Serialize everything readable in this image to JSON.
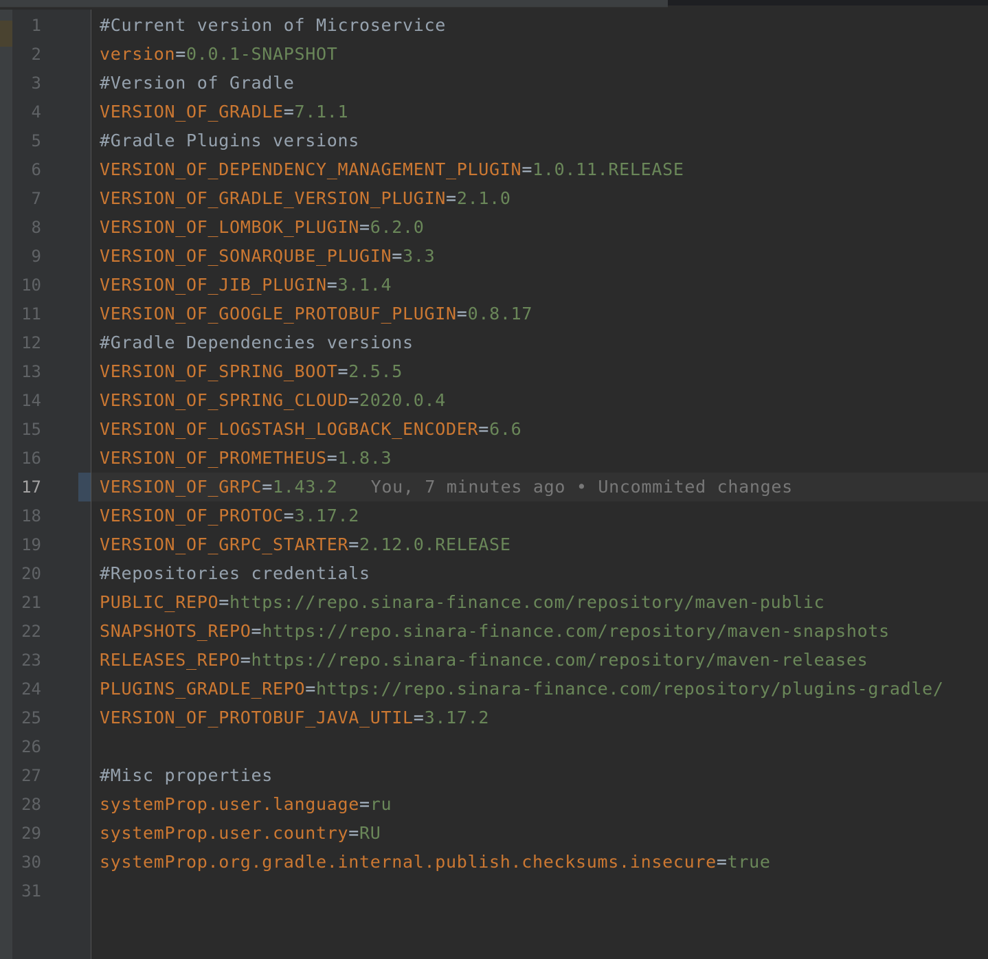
{
  "editor": {
    "current_line": 17,
    "inline_blame": "You, 7 minutes ago • Uncommited changes",
    "lines": [
      {
        "num": "1",
        "type": "comment",
        "text": "#Current version of Microservice"
      },
      {
        "num": "2",
        "type": "prop",
        "key": "version",
        "eq": "=",
        "value": "0.0.1-SNAPSHOT"
      },
      {
        "num": "3",
        "type": "comment",
        "text": "#Version of Gradle"
      },
      {
        "num": "4",
        "type": "prop",
        "key": "VERSION_OF_GRADLE",
        "eq": "=",
        "value": "7.1.1"
      },
      {
        "num": "5",
        "type": "comment",
        "text": "#Gradle Plugins versions"
      },
      {
        "num": "6",
        "type": "prop",
        "key": "VERSION_OF_DEPENDENCY_MANAGEMENT_PLUGIN",
        "eq": "=",
        "value": "1.0.11.RELEASE"
      },
      {
        "num": "7",
        "type": "prop",
        "key": "VERSION_OF_GRADLE_VERSION_PLUGIN",
        "eq": "=",
        "value": "2.1.0"
      },
      {
        "num": "8",
        "type": "prop",
        "key": "VERSION_OF_LOMBOK_PLUGIN",
        "eq": "=",
        "value": "6.2.0"
      },
      {
        "num": "9",
        "type": "prop",
        "key": "VERSION_OF_SONARQUBE_PLUGIN",
        "eq": "=",
        "value": "3.3"
      },
      {
        "num": "10",
        "type": "prop",
        "key": "VERSION_OF_JIB_PLUGIN",
        "eq": "=",
        "value": "3.1.4"
      },
      {
        "num": "11",
        "type": "prop",
        "key": "VERSION_OF_GOOGLE_PROTOBUF_PLUGIN",
        "eq": "=",
        "value": "0.8.17"
      },
      {
        "num": "12",
        "type": "comment",
        "text": "#Gradle Dependencies versions"
      },
      {
        "num": "13",
        "type": "prop",
        "key": "VERSION_OF_SPRING_BOOT",
        "eq": "=",
        "value": "2.5.5"
      },
      {
        "num": "14",
        "type": "prop",
        "key": "VERSION_OF_SPRING_CLOUD",
        "eq": "=",
        "value": "2020.0.4"
      },
      {
        "num": "15",
        "type": "prop",
        "key": "VERSION_OF_LOGSTASH_LOGBACK_ENCODER",
        "eq": "=",
        "value": "6.6"
      },
      {
        "num": "16",
        "type": "prop",
        "key": "VERSION_OF_PROMETHEUS",
        "eq": "=",
        "value": "1.8.3"
      },
      {
        "num": "17",
        "type": "prop",
        "key": "VERSION_OF_GRPC",
        "eq": "=",
        "value": "1.43.2"
      },
      {
        "num": "18",
        "type": "prop",
        "key": "VERSION_OF_PROTOC",
        "eq": "=",
        "value": "3.17.2"
      },
      {
        "num": "19",
        "type": "prop",
        "key": "VERSION_OF_GRPC_STARTER",
        "eq": "=",
        "value": "2.12.0.RELEASE"
      },
      {
        "num": "20",
        "type": "comment",
        "text": "#Repositories credentials"
      },
      {
        "num": "21",
        "type": "prop",
        "key": "PUBLIC_REPO",
        "eq": "=",
        "value": "https://repo.sinara-finance.com/repository/maven-public"
      },
      {
        "num": "22",
        "type": "prop",
        "key": "SNAPSHOTS_REPO",
        "eq": "=",
        "value": "https://repo.sinara-finance.com/repository/maven-snapshots"
      },
      {
        "num": "23",
        "type": "prop",
        "key": "RELEASES_REPO",
        "eq": "=",
        "value": "https://repo.sinara-finance.com/repository/maven-releases"
      },
      {
        "num": "24",
        "type": "prop",
        "key": "PLUGINS_GRADLE_REPO",
        "eq": "=",
        "value": "https://repo.sinara-finance.com/repository/plugins-gradle/"
      },
      {
        "num": "25",
        "type": "prop",
        "key": "VERSION_OF_PROTOBUF_JAVA_UTIL",
        "eq": "=",
        "value": "3.17.2"
      },
      {
        "num": "26",
        "type": "empty"
      },
      {
        "num": "27",
        "type": "comment",
        "text": "#Misc properties"
      },
      {
        "num": "28",
        "type": "prop",
        "key": "systemProp.user.language",
        "eq": "=",
        "value": "ru"
      },
      {
        "num": "29",
        "type": "prop",
        "key": "systemProp.user.country",
        "eq": "=",
        "value": "RU"
      },
      {
        "num": "30",
        "type": "prop",
        "key": "systemProp.org.gradle.internal.publish.checksums.insecure",
        "eq": "=",
        "value": "true"
      },
      {
        "num": "31",
        "type": "empty"
      }
    ]
  },
  "colors": {
    "background": "#2b2b2b",
    "gutter": "#313335",
    "key": "#cc7832",
    "value": "#6a8759",
    "comment": "#a9b7c6",
    "line_number": "#606366",
    "blame": "#787878"
  }
}
